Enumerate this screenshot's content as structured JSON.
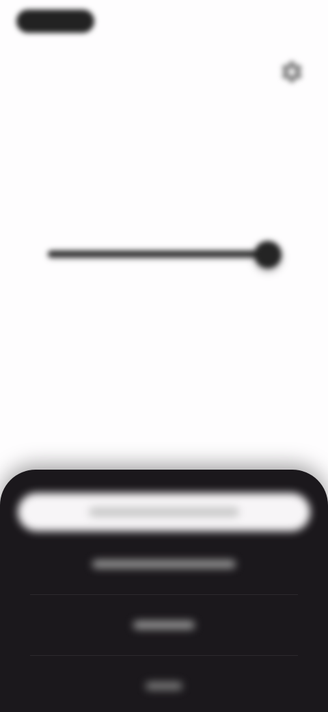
{
  "screen": {
    "top_left_pill_label": "",
    "gear_icon_name": "gear-icon",
    "slider": {
      "value_fraction": 0.92,
      "accent": "#222222"
    },
    "sheet": {
      "primary_button_label": "",
      "rows": [
        {
          "label": ""
        },
        {
          "label": ""
        },
        {
          "label": ""
        }
      ]
    }
  },
  "colors": {
    "background": "#fefdfe",
    "sheet": "#1b181c",
    "primary_button": "#f7f5f7"
  }
}
